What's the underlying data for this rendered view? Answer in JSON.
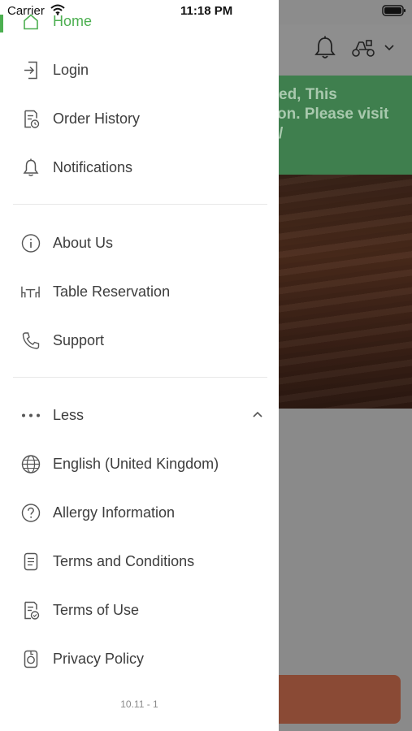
{
  "status_bar": {
    "carrier": "Carrier",
    "time": "11:18 PM"
  },
  "background": {
    "banner_lines": [
      "ed, This",
      "on. Please visit",
      "/"
    ]
  },
  "menu": {
    "home": "Home",
    "login": "Login",
    "order_history": "Order History",
    "notifications": "Notifications",
    "about_us": "About Us",
    "table_reservation": "Table Reservation",
    "support": "Support",
    "less": "Less",
    "language": "English (United Kingdom)",
    "allergy": "Allergy Information",
    "terms_conditions": "Terms and Conditions",
    "terms_use": "Terms of Use",
    "privacy": "Privacy Policy"
  },
  "version": "10.11 - 1",
  "colors": {
    "accent": "#4caf50",
    "banner": "#3f7f4e",
    "text": "#3d3d3d"
  }
}
